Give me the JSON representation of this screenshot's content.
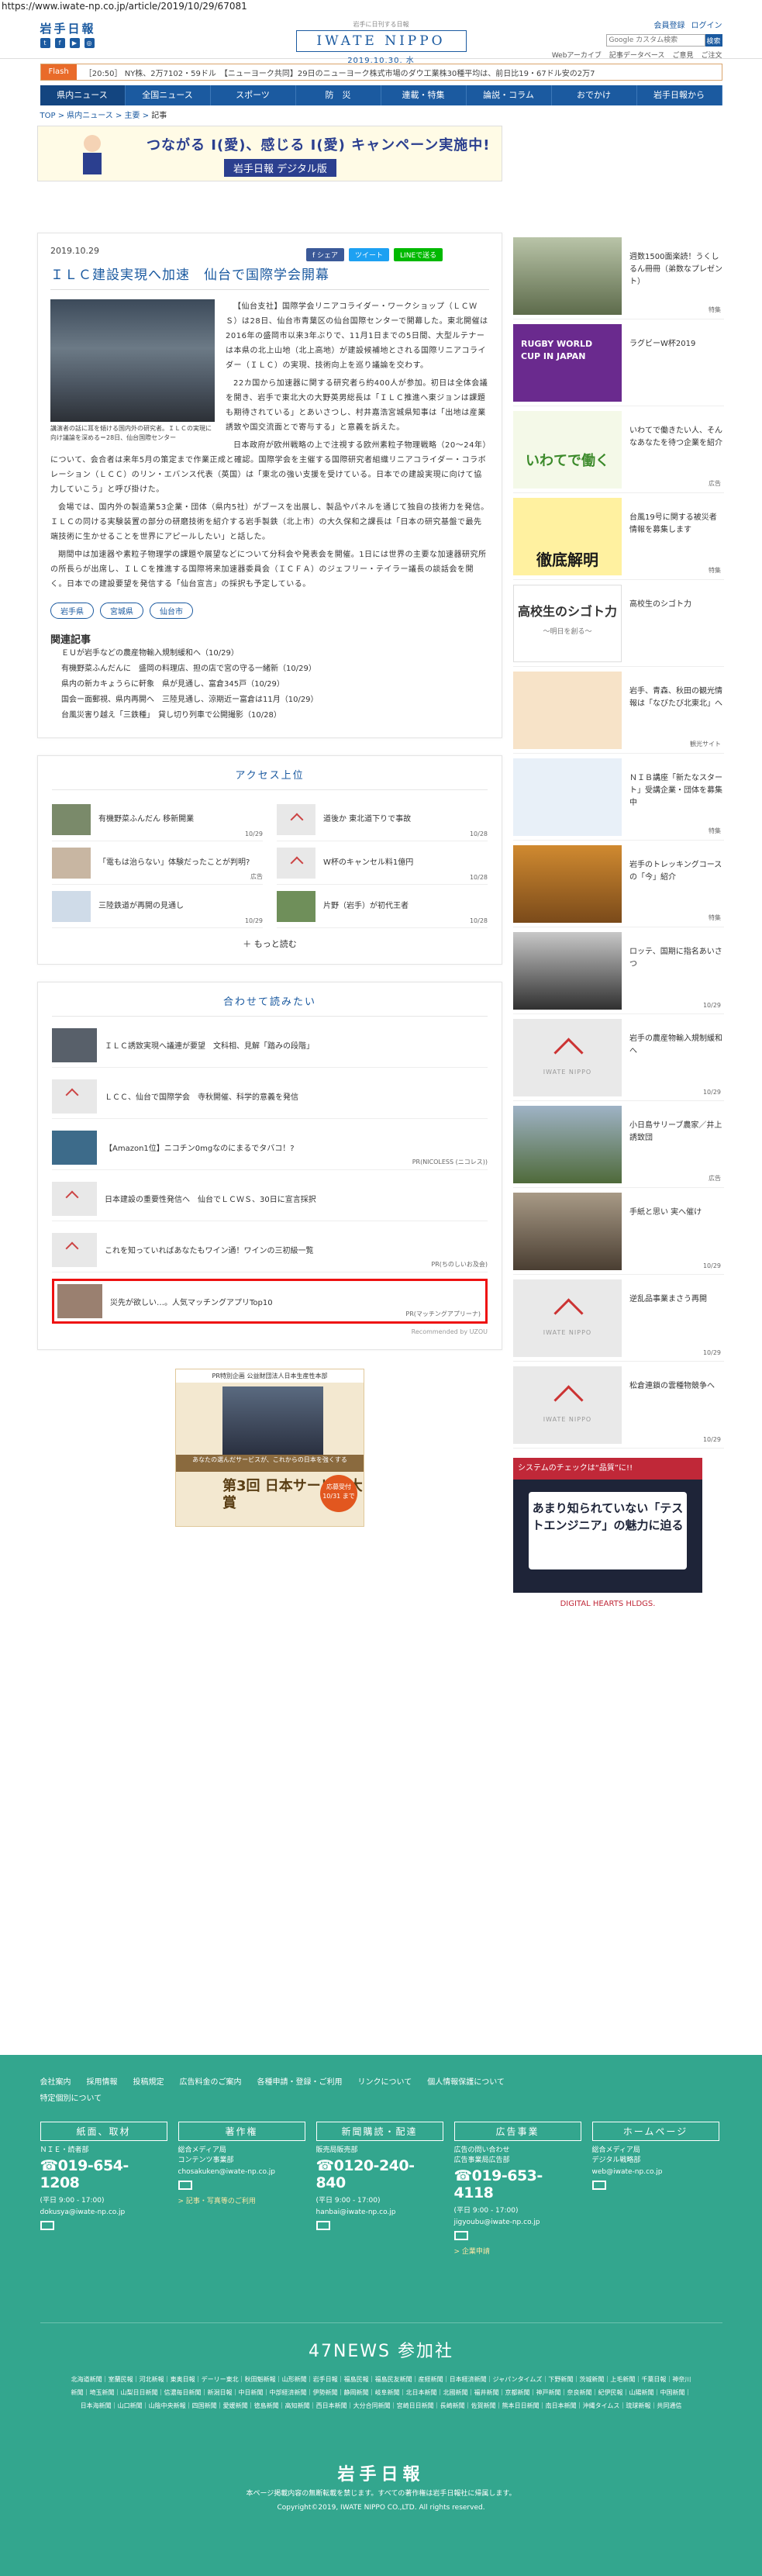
{
  "url": "https://www.iwate-np.co.jp/article/2019/10/29/67081",
  "header": {
    "logo_jp": "岩手日報",
    "tagline": "岩手に日刊する日報",
    "brand": "IWATE NIPPO",
    "date": "2019.10.30. 水",
    "member_login": "会員登録",
    "login": "ログイン",
    "search_placeholder": "Google カスタム検索",
    "search_button": "検索",
    "sub_links": [
      "Webアーカイブ",
      "記事データベース",
      "ご意見",
      "ご注文"
    ]
  },
  "flash": {
    "label": "Flash",
    "text": "［20:50］ NY株、2万7102・59ドル　【ニューヨーク共同】29日のニューヨーク株式市場のダウ工業株30種平均は、前日比19・67ドル安の2万7"
  },
  "nav": [
    "県内ニュース",
    "全国ニュース",
    "スポーツ",
    "防　災",
    "連載・特集",
    "論説・コラム",
    "おでかけ",
    "岩手日報から"
  ],
  "breadcrumb": [
    "TOP",
    "県内ニュース",
    "主要",
    "記事"
  ],
  "banner": {
    "title": "つながる I(愛)、感じる I(愛) キャンペーン実施中!",
    "sub": "岩手日報 デジタル版"
  },
  "article": {
    "date": "2019.10.29",
    "share_fb": "f シェア",
    "share_tw": "ツイート",
    "share_line": "LINEで送る",
    "title": "ＩＬＣ建設実現へ加速　仙台で国際学会開幕",
    "caption": "講演者の話に耳を傾ける国内外の研究者。ＩＬＣの実現に向け議論を深める＝28日、仙台国際センター",
    "paragraphs": [
      "【仙台支社】国際学会リニアコライダー・ワークショップ（ＬＣＷＳ）は28日、仙台市青葉区の仙台国際センターで開幕した。東北開催は2016年の盛岡市以来3年ぶりで、11月1日までの5日間、大型ルテナーは本県の北上山地（北上高地）が建設候補地とされる国際リニアコライダー（ＩＬＣ）の実現、技術向上を巡り議論を交わす。",
      "22カ国から加速器に関する研究者ら約400人が参加。初日は全体会議を開き、岩手で東北大の大野英男総長は「ＩＬＣ推進へ東ジョンは課題も期待されている」とあいさつし、村井嘉浩宮城県知事は「出地は産業誘致や国交流面とで寄与する」と意義を訴えた。",
      "日本政府が欧州戦略の上で注視する欧州素粒子物理戦略（20～24年）について、会合者は来年5月の策定まで作業正成と確認。国際学会を主催する国際研究者組織リニアコライダー・コラボレーション（ＬＣＣ）のリン・エバンス代表（英国）は「東北の強い支援を受けている。日本での建設実現に向けて協力していこう」と呼び掛けた。",
      "会場では、国内外の製造業53企業・団体（県内5社）がブースを出展し、製品やパネルを通じて独自の技術力を発信。ＩＬＣの同ける実験装置の部分の研磨技術を紹介する岩手製鉄（北上市）の大久保和之課長は「日本の研究基盤で最先端技術に生かせることを世界にアピールしたい」と話した。",
      "期間中は加速器や素粒子物理学の課題や展望などについて分科会や発表会を開催。1日には世界の主要な加速器研究所の所長らが出席し、ＩＬＣを推進する国際将来加速器委員会（ＩＣＦＡ）のジェフリー・テイラー議長の談話会を開く。日本での建設要望を発信する「仙台宣言」の採択も予定している。"
    ],
    "tags": [
      "岩手県",
      "宮城県",
      "仙台市"
    ],
    "related_heading": "関連記事",
    "related": [
      "ＥＵが岩手などの農産物輸入規制緩和へ（10/29）",
      "有機野菜ふんだんに　盛岡の料理店、担の店で宮の守る一緒新（10/29）",
      "県内の新カキょうらに軒象　県が見通し、富倉345戸（10/29）",
      "国会ー面郵視、県内再開へ　三陸見通し、涼期近ー富倉は11月（10/29）",
      "台風災害り越え「三鉄種」　貸し切り列車で公開撮影（10/28）"
    ]
  },
  "ranking": {
    "heading": "アクセス上位",
    "items": [
      {
        "title": "有機野菜ふんだん 移新開業",
        "date": "10/29"
      },
      {
        "title": "道後か 東北道下りで事故",
        "date": "10/28"
      },
      {
        "title": "「電もは治らない」体験だったことが判明?",
        "date": "広告"
      },
      {
        "title": "W杯のキャンセル料1億円",
        "date": "10/28"
      },
      {
        "title": "三陸鉄道が再開の見通し",
        "date": "10/29"
      },
      {
        "title": "片野（岩手）が初代王者",
        "date": "10/28"
      }
    ],
    "more": "もっと読む"
  },
  "recommend": {
    "heading": "合わせて読みたい",
    "items": [
      {
        "title": "ＩＬＣ誘致実現へ議連が要望　文科相、見解「踏みの段階」",
        "source": ""
      },
      {
        "title": "ＬＣＣ、仙台で国際学会　寺秋開催、科学的意義を発信",
        "source": ""
      },
      {
        "title": "【Amazon1位】ニコチン0mgなのにまるでタバコ！?",
        "source": "PR(NICOLESS (ニコレス))"
      },
      {
        "title": "日本建設の重要性発信へ　仙台でＬＣＷＳ、30日に宣言採択",
        "source": ""
      },
      {
        "title": "これを知っていればあなたもワイン通！ワインの三初級一覧",
        "source": "PR(ちのしいお及会)"
      },
      {
        "title": "災先が欲しい…。人気マッチングアプリTop10",
        "source": "PR(マッチングアプリーナ)"
      }
    ],
    "powered": "Recommended by UZOU"
  },
  "ad_center": {
    "top": "PR特別企画 公益財団法人日本生産性本部",
    "mid": "あなたの選んだサービスが、これからの日本を強くする",
    "big": "第3回 日本サービス大賞",
    "circle": "応募受付 10/31 まで"
  },
  "sidebar": {
    "items": [
      {
        "title": "週数1500面楽読！うくしるん冊冊（弟数なプレゼント）",
        "date": "特集"
      },
      {
        "title": "ラグビーW杯2019",
        "date": ""
      },
      {
        "title": "いわてで働きたい人、そんなあなたを待つ企業を紹介",
        "date": "広告"
      },
      {
        "title": "台風19号に関する被災者情報を募集します",
        "date": "特集"
      },
      {
        "title": "高校生のシゴト力",
        "date": ""
      },
      {
        "title": "岩手、青森、秋田の観光情報は「なびたび北東北」へ",
        "date": "観光サイト"
      },
      {
        "title": "ＮＩＢ講座「新たなスタート」受講企業・団体を募集中",
        "date": "特集"
      },
      {
        "title": "岩手のトレッキングコースの「今」紹介",
        "date": "特集"
      },
      {
        "title": "ロッテ、国期に指名あいさつ",
        "date": "10/29"
      },
      {
        "title": "岩手の農産物輸入規制緩和へ",
        "date": "10/29"
      },
      {
        "title": "小日島サリーブ農家／井上誘致団",
        "date": "広告"
      },
      {
        "title": "手紙と思い 実へ催け",
        "date": "10/29"
      },
      {
        "title": "逆乱品事業まさう再開",
        "date": "10/29"
      },
      {
        "title": "松倉連鎖の雲種物競争へ",
        "date": "10/29"
      }
    ],
    "rugby_text": "RUGBY WORLD CUP IN JAPAN",
    "iwate_text": "いわてで働く",
    "typhoon_text": "徹底解明",
    "shigoto_text": "高校生のシゴト力",
    "shigoto_sub": "〜明日を創る〜",
    "ad": {
      "top": "システムのチェックは“品質”に!!",
      "main": "あまり知られていない「テストエンジニア」の魅力に迫る",
      "foot": "DIGITAL HEARTS HLDGS."
    }
  },
  "footer": {
    "links": [
      "会社案内",
      "採用情報",
      "投稿規定",
      "広告料金のご案内",
      "各種申請・登録・ご利用",
      "リンクについて",
      "個人情報保護について",
      "特定個別について"
    ],
    "cols": [
      {
        "head": "紙面、取材",
        "label": "ＮＩＥ・読者部",
        "tel": "019-654-1208",
        "hours": "(平日 9:00 - 17:00)",
        "mail": "dokusya@iwate-np.co.jp",
        "link": ""
      },
      {
        "head": "著作権",
        "label": "総合メディア局\nコンテンツ事業部",
        "tel": "",
        "hours": "",
        "mail": "chosakuken@iwate-np.co.jp",
        "link": "> 記事・写真等のご利用"
      },
      {
        "head": "新聞購読・配達",
        "label": "販売局販売部",
        "tel": "0120-240-840",
        "hours": "(平日 9:00 - 17:00)",
        "mail": "hanbai@iwate-np.co.jp",
        "link": ""
      },
      {
        "head": "広告事業",
        "label": "広告の問い合わせ\n広告事業局広告部",
        "tel": "019-653-4118",
        "hours": "(平日 9:00 - 17:00)",
        "mail": "jigyoubu@iwate-np.co.jp",
        "link": "> 企業申請"
      },
      {
        "head": "ホームページ",
        "label": "総合メディア局\nデジタル戦略部",
        "tel": "",
        "hours": "",
        "mail": "web@iwate-np.co.jp",
        "link": ""
      }
    ],
    "n47": "47NEWS 参加社",
    "n47_list": "北海道新聞｜室蘭民報｜河北新報｜東奥日報｜デーリー東北｜秋田魁新報｜山形新聞｜岩手日報｜福島民報｜福島民友新聞｜産経新聞｜日本経済新聞｜ジャパンタイムズ｜下野新聞｜茨城新聞｜上毛新聞｜千葉日報｜神奈川新聞｜埼玉新聞｜山梨日日新聞｜信濃毎日新聞｜新潟日報｜中日新聞｜中部経済新聞｜伊勢新聞｜静岡新聞｜岐阜新聞｜北日本新聞｜北國新聞｜福井新聞｜京都新聞｜神戸新聞｜奈良新聞｜紀伊民報｜山陽新聞｜中国新聞｜日本海新聞｜山口新聞｜山陰中央新報｜四国新聞｜愛媛新聞｜徳島新聞｜高知新聞｜西日本新聞｜大分合同新聞｜宮崎日日新聞｜長崎新聞｜佐賀新聞｜熊本日日新聞｜南日本新聞｜沖縄タイムス｜琉球新報｜共同通信",
    "logo": "岩手日報",
    "copy1": "本ページ掲載内容の無断転載を禁じます。すべての著作権は岩手日報社に帰属します。",
    "copy2": "Copyright©2019, IWATE NIPPO CO.,LTD. All rights reserved."
  }
}
